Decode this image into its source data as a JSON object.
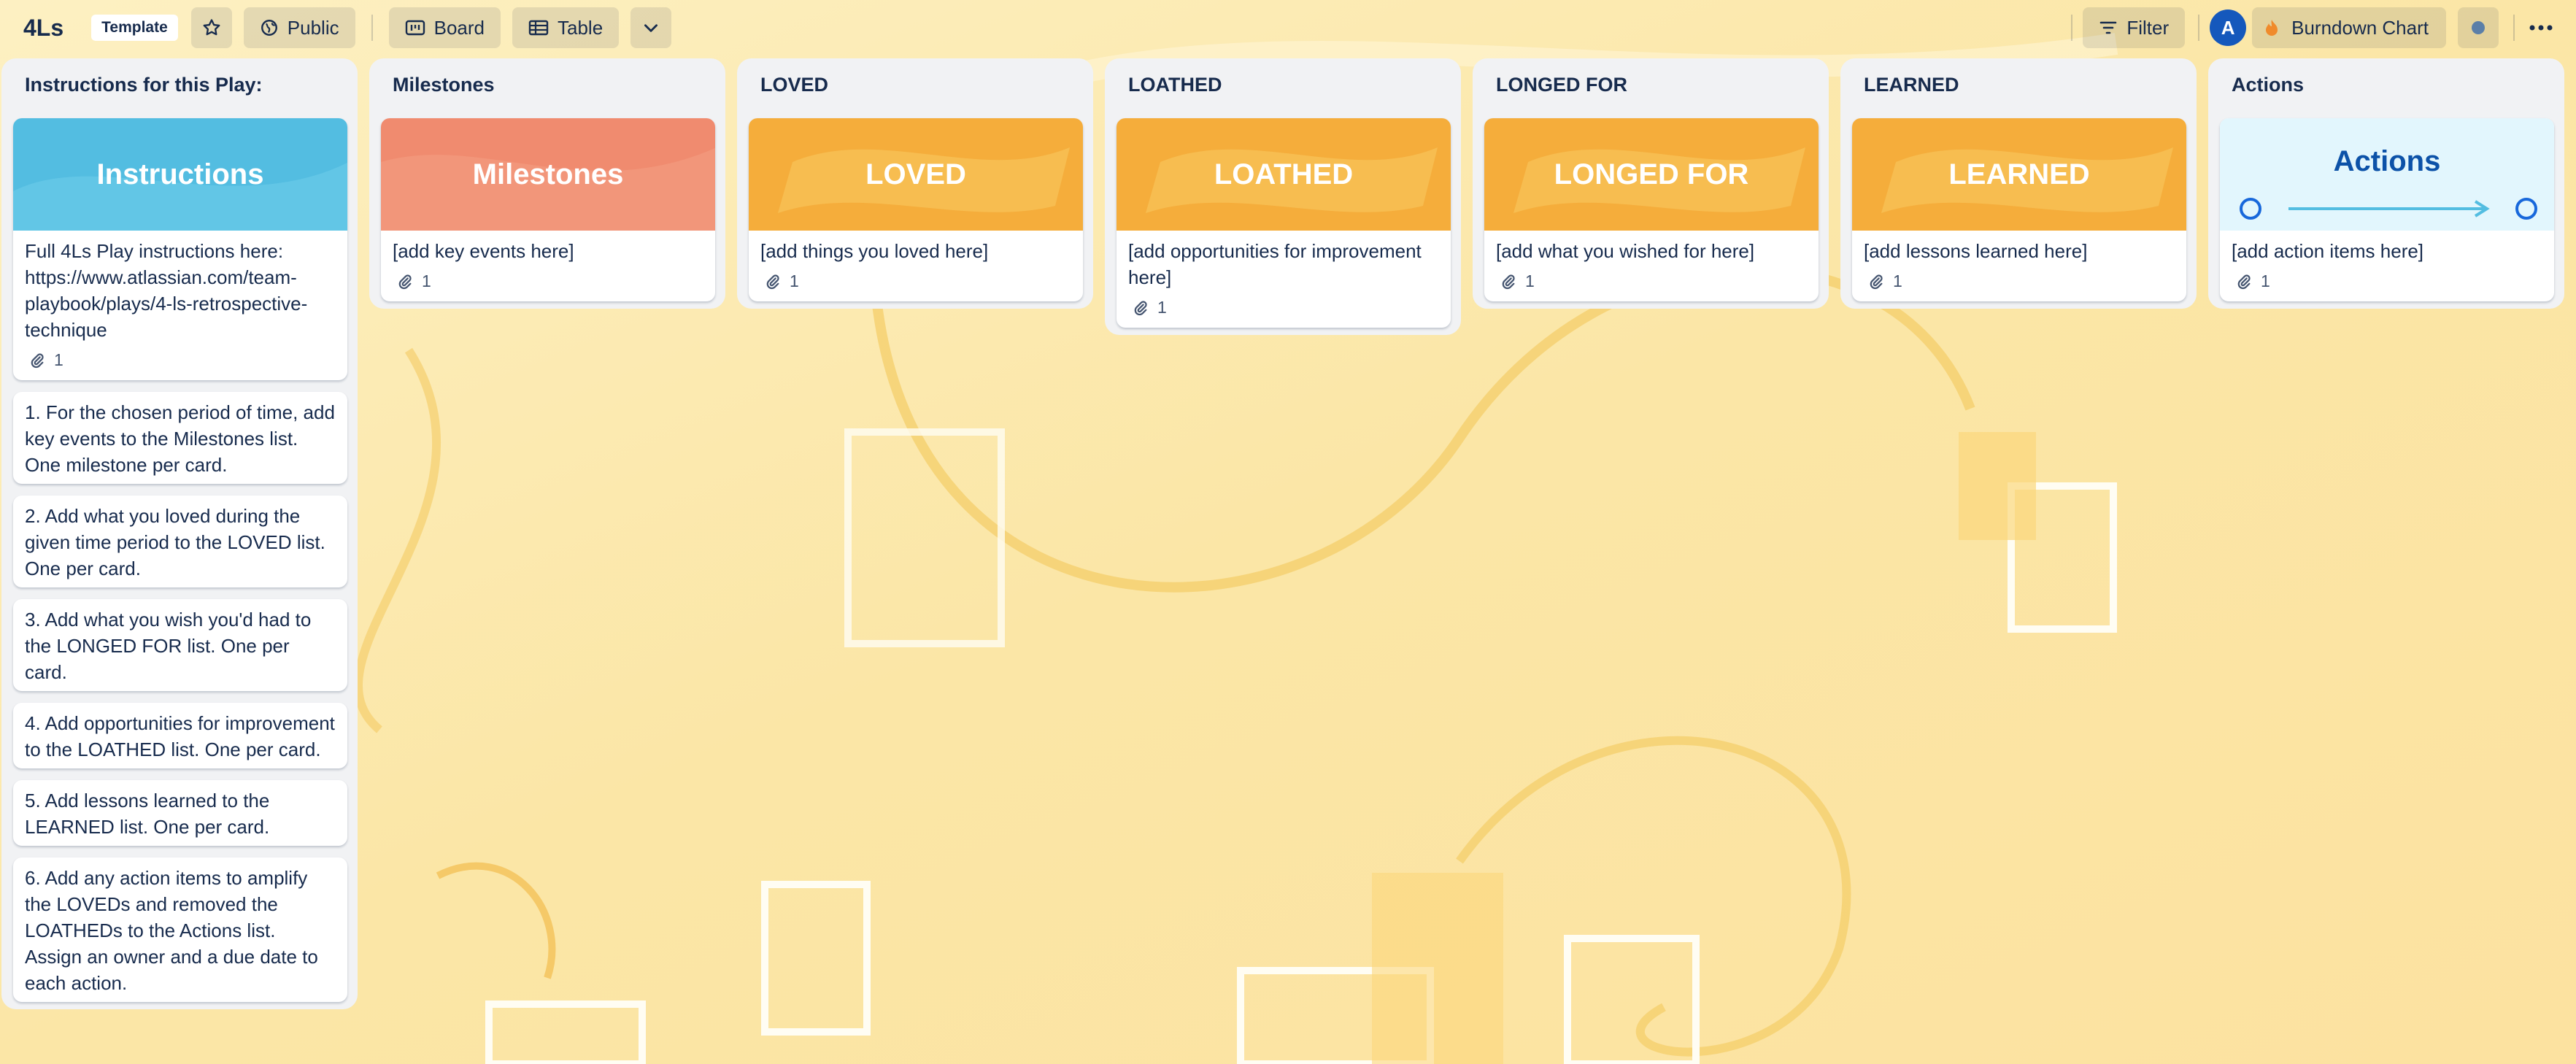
{
  "board": {
    "title": "4Ls",
    "template_badge": "Template",
    "visibility": "Public",
    "views": [
      "Board",
      "Table"
    ],
    "filter_label": "Filter",
    "powerup_label": "Burndown Chart",
    "avatar_initial": "A"
  },
  "icons": {
    "star": "star-icon",
    "globe": "globe-icon",
    "board": "board-icon",
    "table": "table-icon",
    "chevron": "chevron-down-icon",
    "filter": "filter-icon",
    "flame": "flame-icon",
    "attachment": "paperclip-icon",
    "more": "ellipsis-icon"
  },
  "colors": {
    "instructions_cover": "#53bde1",
    "milestones_cover": "#f08b6f",
    "orange_cover": "#f5ad3b",
    "actions_cover": "#e2f6fd",
    "actions_text": "#0c52a8"
  },
  "lists": [
    {
      "title": "Instructions for this Play:",
      "cover_label": "Instructions",
      "cards": [
        {
          "text": "Full 4Ls Play instructions here: https://www.atlassian.com/team-playbook/plays/4-ls-retrospective-technique",
          "attachments": "1"
        },
        {
          "text": "1. For the chosen period of time, add key events to the Milestones list. One milestone per card."
        },
        {
          "text": "2. Add what you loved during the given time period to the LOVED list. One per card."
        },
        {
          "text": "3. Add what you wish you'd had to the LONGED FOR list. One per card."
        },
        {
          "text": "4. Add opportunities for improvement to the LOATHED list. One per card."
        },
        {
          "text": "5. Add lessons learned to the LEARNED list. One per card."
        },
        {
          "text": "6. Add any action items to amplify the LOVEDs and removed the LOATHEDs to the Actions list. Assign an owner and a due date to each action."
        }
      ]
    },
    {
      "title": "Milestones",
      "cover_label": "Milestones",
      "cards": [
        {
          "text": "[add key events here]",
          "attachments": "1"
        }
      ]
    },
    {
      "title": "LOVED",
      "cover_label": "LOVED",
      "cards": [
        {
          "text": "[add things you loved here]",
          "attachments": "1"
        }
      ]
    },
    {
      "title": "LOATHED",
      "cover_label": "LOATHED",
      "cards": [
        {
          "text": "[add opportunities for improvement here]",
          "attachments": "1"
        }
      ]
    },
    {
      "title": "LONGED FOR",
      "cover_label": "LONGED FOR",
      "cards": [
        {
          "text": "[add what you wished for here]",
          "attachments": "1"
        }
      ]
    },
    {
      "title": "LEARNED",
      "cover_label": "LEARNED",
      "cards": [
        {
          "text": "[add lessons learned here]",
          "attachments": "1"
        }
      ]
    },
    {
      "title": "Actions",
      "cover_label": "Actions",
      "cards": [
        {
          "text": "[add action items here]",
          "attachments": "1"
        }
      ]
    }
  ]
}
